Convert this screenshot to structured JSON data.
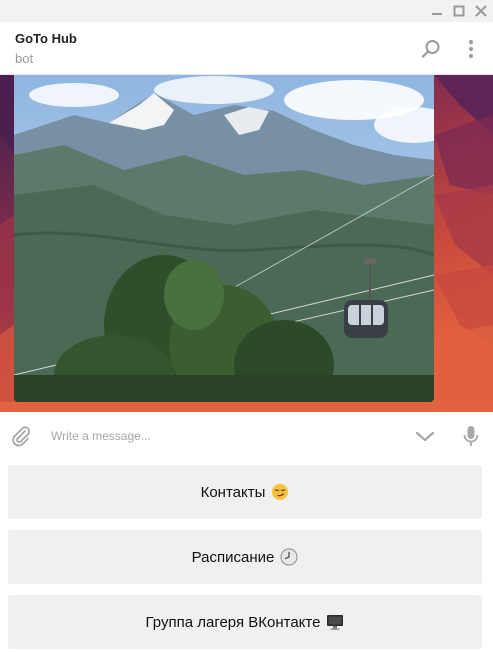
{
  "window": {
    "controls": [
      "minimize-icon",
      "maximize-icon",
      "close-icon"
    ]
  },
  "header": {
    "title": "GoTo Hub",
    "subtitle": "bot",
    "icons": [
      "search-icon",
      "more-vertical-icon"
    ]
  },
  "chat": {
    "message_type": "photo",
    "background_colors": [
      "#3d1f4f",
      "#c24a3f",
      "#e0573d"
    ]
  },
  "composer": {
    "placeholder": "Write a message...",
    "value": "",
    "icons": [
      "paperclip-icon",
      "chevron-down-icon",
      "microphone-icon"
    ]
  },
  "keyboard": {
    "buttons": [
      {
        "label": "Контакты",
        "emoji": "smirk-face-icon"
      },
      {
        "label": "Расписание",
        "emoji": "clock-icon"
      },
      {
        "label": "Группа лагеря ВКонтакте",
        "emoji": "desktop-computer-icon"
      }
    ]
  },
  "colors": {
    "button_bg": "#f0f0f0",
    "header_bg": "#ffffff",
    "subtitle": "#999999"
  }
}
